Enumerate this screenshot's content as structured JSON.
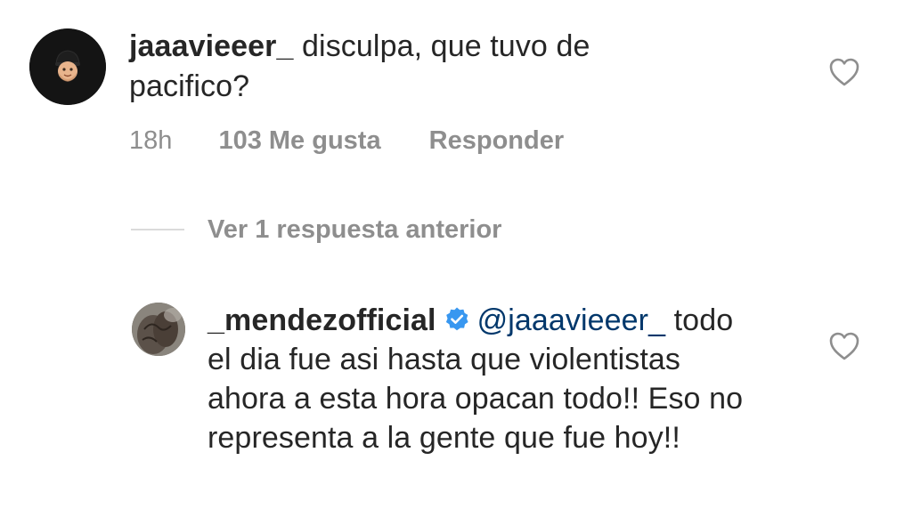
{
  "comment": {
    "username": "jaaavieeer_",
    "text": "disculpa, que tuvo de pacifico?",
    "time": "18h",
    "likes": "103 Me gusta",
    "reply_label": "Responder",
    "avatar_icon": "memoji-avatar-icon"
  },
  "view_replies": {
    "label": "Ver 1 respuesta anterior"
  },
  "reply": {
    "username": "_mendezofficial",
    "verified": true,
    "mention": "@jaaavieeer_",
    "text": "todo el dia fue asi hasta que violentistas ahora a esta hora opacan todo!! Eso no representa a la gente que fue hoy!!",
    "avatar_icon": "profile-photo-avatar-icon"
  },
  "colors": {
    "text": "#262626",
    "secondary": "#8e8e8e",
    "mention": "#00376b",
    "verified": "#3897f0",
    "divider": "#dbdbdb"
  },
  "icons": {
    "like": "heart-outline-icon",
    "verified": "verified-badge-icon"
  }
}
